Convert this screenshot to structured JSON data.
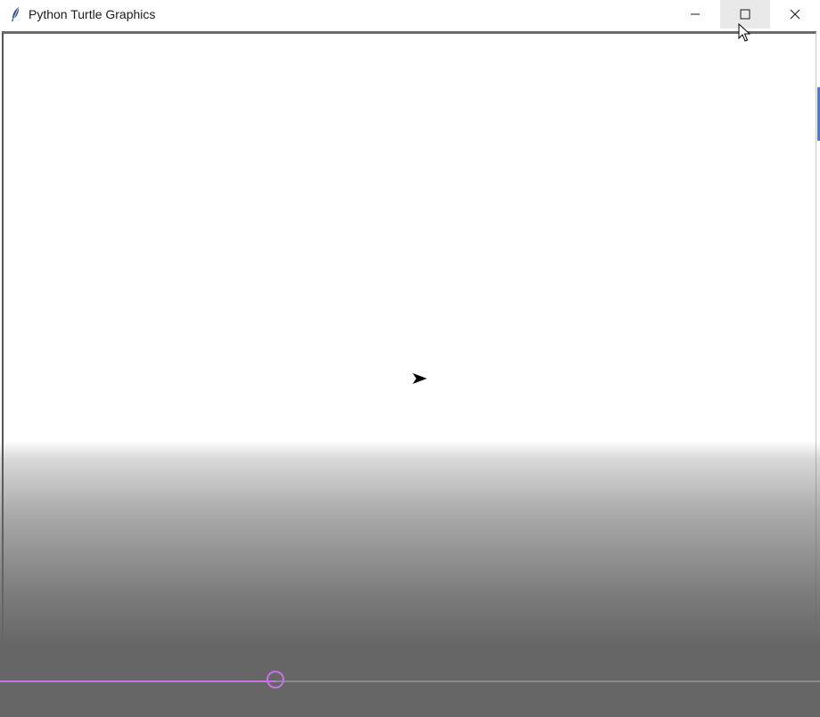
{
  "window": {
    "title": "Python Turtle Graphics",
    "app_icon": "feather-icon"
  },
  "controls": {
    "minimize_icon": "minimize-icon",
    "maximize_icon": "maximize-icon",
    "close_icon": "close-icon"
  },
  "canvas": {
    "background": "#ffffff",
    "turtle_icon": "turtle-arrow-icon",
    "turtle_color": "#000000"
  },
  "player": {
    "progress": 0.337,
    "progress_color": "#c872e8",
    "track_color": "#8a8a8a",
    "overlay_color": "#666666"
  }
}
